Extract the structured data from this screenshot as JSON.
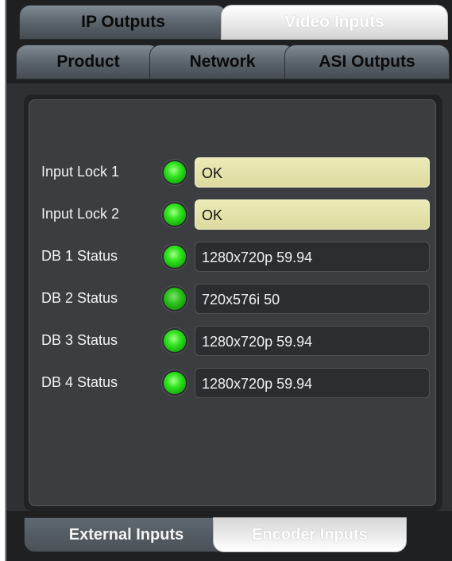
{
  "tabs_top": [
    {
      "label": "IP Outputs",
      "active": false
    },
    {
      "label": "Video Inputs",
      "active": true
    }
  ],
  "tabs_second": [
    {
      "label": "Product",
      "active": false
    },
    {
      "label": "Network",
      "active": false
    },
    {
      "label": "ASI Outputs",
      "active": false
    }
  ],
  "status_rows": [
    {
      "label": "Input Lock 1",
      "value": "OK",
      "led_color": "#2fd61d",
      "style": "ok"
    },
    {
      "label": "Input Lock 2",
      "value": "OK",
      "led_color": "#2fd61d",
      "style": "ok"
    },
    {
      "label": "DB 1 Status",
      "value": "1280x720p 59.94",
      "led_color": "#2fd61d",
      "style": "status"
    },
    {
      "label": "DB 2 Status",
      "value": "720x576i 50",
      "led_color": "#2fd61d",
      "style": "status"
    },
    {
      "label": "DB 3 Status",
      "value": "1280x720p 59.94",
      "led_color": "#2fd61d",
      "style": "status"
    },
    {
      "label": "DB 4 Status",
      "value": "1280x720p 59.94",
      "led_color": "#2fd61d",
      "style": "status"
    }
  ],
  "tabs_bottom": [
    {
      "label": "External Inputs",
      "active": true
    },
    {
      "label": "Encoder Inputs",
      "active": false
    }
  ],
  "colors": {
    "panel_bg": "#3b3d40",
    "ok_field": "#e4e3aa",
    "led_green": "#2fd61d"
  }
}
